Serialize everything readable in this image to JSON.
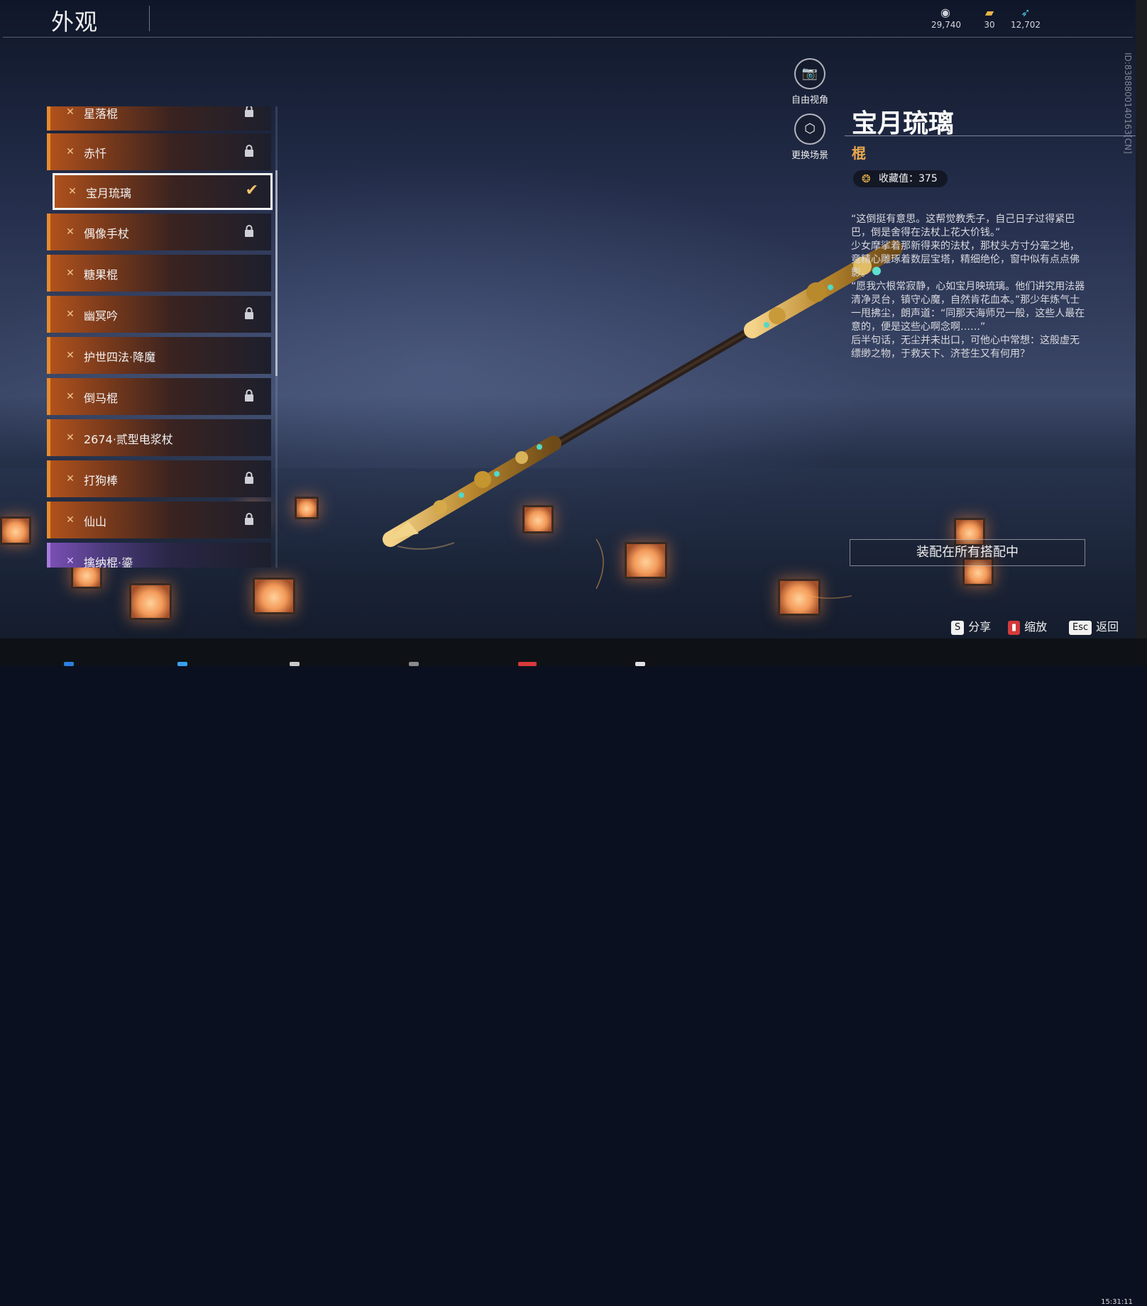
{
  "header": {
    "title": "外观",
    "currencies": [
      {
        "icon": "coin-icon",
        "value": "29,740"
      },
      {
        "icon": "ticket-icon",
        "value": "30"
      },
      {
        "icon": "feather-icon",
        "value": "12,702"
      }
    ]
  },
  "vertical_id": "ID:8388800140163[CN]",
  "list": {
    "items": [
      {
        "label": "星落棍",
        "locked": true
      },
      {
        "label": "赤忏",
        "locked": true
      },
      {
        "label": "宝月琉璃",
        "locked": false,
        "selected": true
      },
      {
        "label": "偶像手杖",
        "locked": true
      },
      {
        "label": "糖果棍",
        "locked": false
      },
      {
        "label": "幽冥吟",
        "locked": true
      },
      {
        "label": "护世四法·降魔",
        "locked": false
      },
      {
        "label": "倒马棍",
        "locked": true
      },
      {
        "label": "2674·贰型电浆杖",
        "locked": false
      },
      {
        "label": "打狗棒",
        "locked": true
      },
      {
        "label": "仙山",
        "locked": true
      },
      {
        "label": "擒纳棍·鎏",
        "locked": false
      }
    ]
  },
  "side_buttons": {
    "free_view": "自由视角",
    "change_scene": "更换场景"
  },
  "detail": {
    "name": "宝月琉璃",
    "type": "棍",
    "collection_label": "收藏值：375",
    "description": [
      "“这倒挺有意思。这帮觉教秃子，自己日子过得紧巴巴，倒是舍得在法杖上花大价钱。”",
      "少女摩挲着那新得来的法杖，那杖头方寸分毫之地，竟精心雕琢着数层宝塔，精细绝伦，窗中似有点点佛影。",
      "“愿我六根常寂静，心如宝月映琉璃。他们讲究用法器清净灵台，镇守心魔，自然肯花血本。”那少年炼气士一甩拂尘，朗声道：“同那天海师兄一般，这些人最在意的，便是这些心啊念啊……”",
      "后半句话，无尘并未出口，可他心中常想：这般虚无缥缈之物，于救天下、济苍生又有何用？"
    ],
    "equip_button": "装配在所有搭配中"
  },
  "hints": [
    {
      "key": "S",
      "label": "分享"
    },
    {
      "key": "",
      "label": "缩放",
      "icon": "mouse-icon"
    },
    {
      "key": "Esc",
      "label": "返回"
    }
  ],
  "taskbar": {
    "clock": "15:31:11"
  },
  "colors": {
    "accent_orange": "#e88b2c",
    "gold_text": "#e9a84c",
    "selected_outline": "#f5f5f5"
  }
}
